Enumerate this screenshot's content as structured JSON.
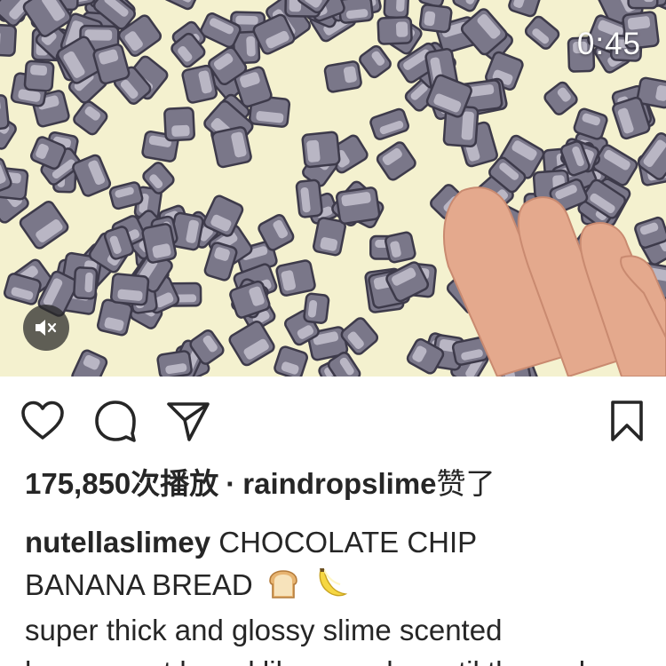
{
  "video": {
    "timer": "0:45",
    "mute_icon": "speaker-muted-icon"
  },
  "actions": {
    "like_icon": "heart-icon",
    "comment_icon": "comment-bubble-icon",
    "share_icon": "paper-plane-icon",
    "save_icon": "bookmark-icon"
  },
  "stats": {
    "views": "175,850次播放",
    "separator": "·",
    "liked_by_user": "raindropslime",
    "liked_suffix": "赞了"
  },
  "caption": {
    "username": "nutellaslimey",
    "line1": "CHOCOLATE CHIP",
    "line2": "BANANA BREAD",
    "emoji": [
      "bread-icon",
      "banana-icon"
    ],
    "line3": "super thick and glossy slime scented",
    "line4": "banana nut bread like crunchy until the end"
  },
  "colors": {
    "video_background": "#f4f1cf",
    "chip": "#7a7789",
    "text": "#262626"
  }
}
